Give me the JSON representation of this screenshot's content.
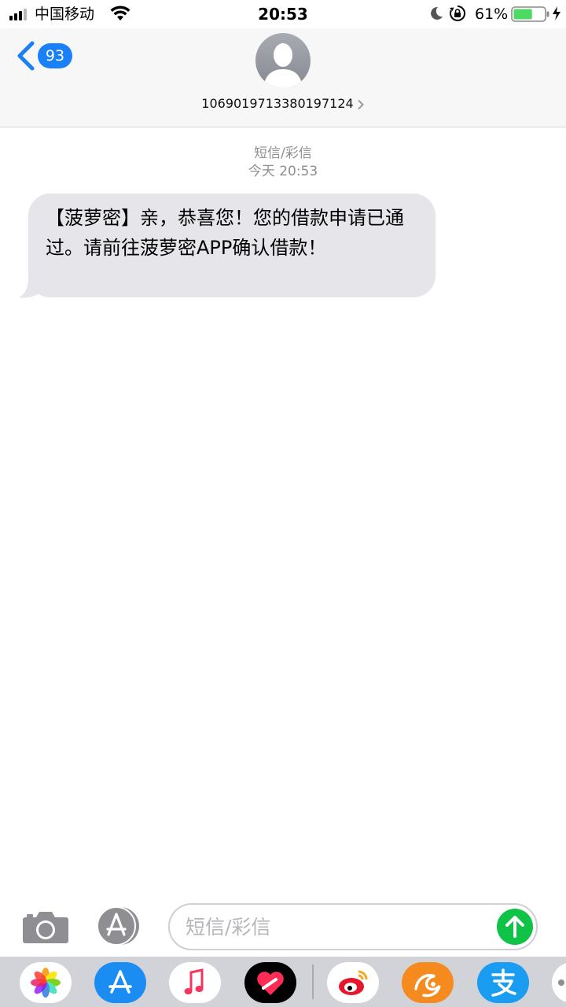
{
  "status_bar": {
    "carrier": "中国移动",
    "time": "20:53",
    "battery_percent": "61%",
    "battery_level": 0.61
  },
  "nav": {
    "back_badge": "93",
    "contact_number": "1069019713380197124"
  },
  "conversation": {
    "message_type": "短信/彩信",
    "timestamp": "今天 20:53",
    "messages": [
      {
        "direction": "incoming",
        "text": "【菠萝密】亲，恭喜您！您的借款申请已通过。请前往菠萝密APP确认借款！"
      }
    ]
  },
  "input_bar": {
    "placeholder": "短信/彩信"
  },
  "app_drawer": {
    "apps": [
      "photos-icon",
      "app-store-icon",
      "music-icon",
      "digital-touch-icon",
      "weibo-icon",
      "uc-browser-icon",
      "alipay-icon",
      "more-icon"
    ]
  },
  "colors": {
    "accent": "#1a80f7",
    "send": "#0fc346",
    "incoming_bubble": "#e5e5ea",
    "meta_text": "#8e8e93"
  }
}
